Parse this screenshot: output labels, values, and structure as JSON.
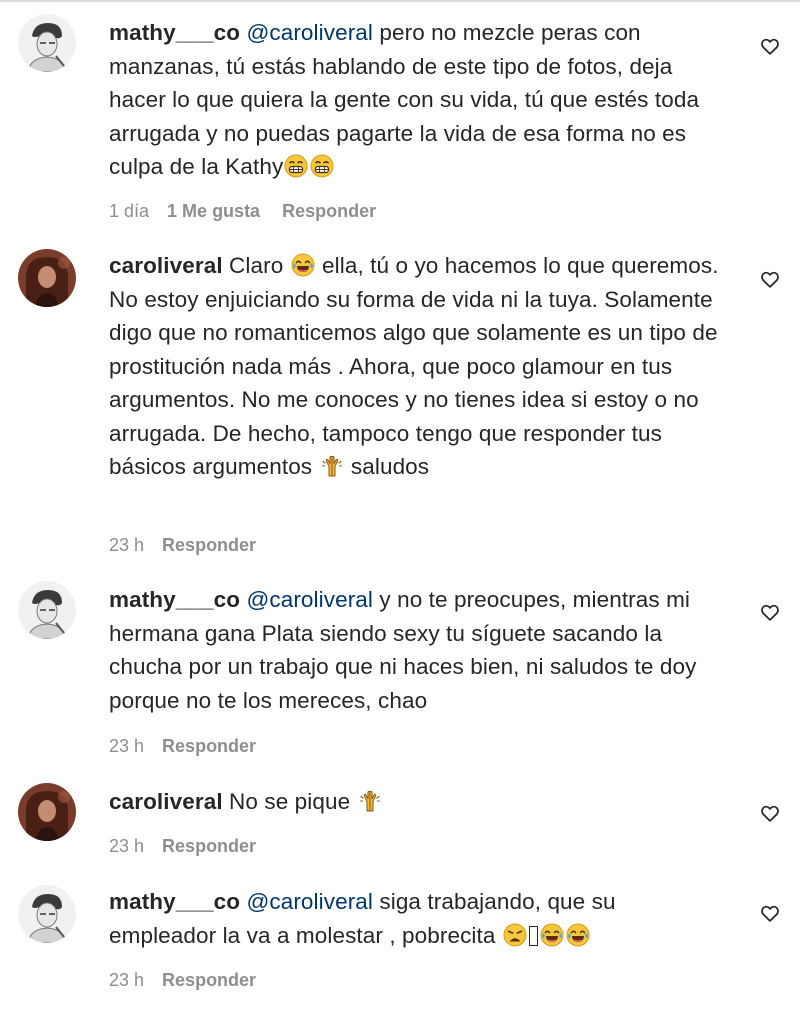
{
  "comments": [
    {
      "user": "mathy___co",
      "mention": "@caroliveral",
      "text": "pero no mezcle peras con manzanas, tú estás hablando de este tipo de fotos, deja hacer lo que quiera la gente con su vida, tú que estés toda arrugada y no puedas pagarte la vida de esa forma no es culpa de la Kathy",
      "time": "1 día",
      "likes": "1 Me gusta",
      "reply": "Responder"
    },
    {
      "user": "caroliveral",
      "text_a": "Claro",
      "text_b": "ella, tú o yo hacemos lo que queremos. No estoy enjuiciando su forma de vida ni la tuya. Solamente digo que no romanticemos algo que solamente es un tipo de prostitución nada más . Ahora, que poco glamour en tus argumentos. No me conoces y no tienes idea si estoy o no arrugada. De hecho, tampoco tengo que responder tus básicos argumentos",
      "text_c": "saludos",
      "time": "23 h",
      "reply": "Responder"
    },
    {
      "user": "mathy___co",
      "mention": "@caroliveral",
      "text": "y no te preocupes, mientras mi hermana gana Plata siendo sexy tu síguete sacando la chucha por un trabajo que ni haces bien, ni saludos te doy porque no te los mereces, chao",
      "time": "23 h",
      "reply": "Responder"
    },
    {
      "user": "caroliveral",
      "text": "No se pique",
      "time": "23 h",
      "reply": "Responder"
    },
    {
      "user": "mathy___co",
      "mention": "@caroliveral",
      "text": "siga trabajando, que su empleador la va a molestar , pobrecita",
      "time": "23 h",
      "reply": "Responder"
    }
  ],
  "icons": {
    "like": "heart-outline-icon",
    "emoji_grin": "grimacing-face-emoji",
    "emoji_laugh": "face-with-tears-of-joy-emoji",
    "emoji_pray": "raised-hands-emoji",
    "emoji_weary": "weary-face-emoji"
  },
  "colors": {
    "text": "#262626",
    "mention": "#00376b",
    "meta": "#8e8e8e",
    "divider": "#dbdbdb"
  }
}
